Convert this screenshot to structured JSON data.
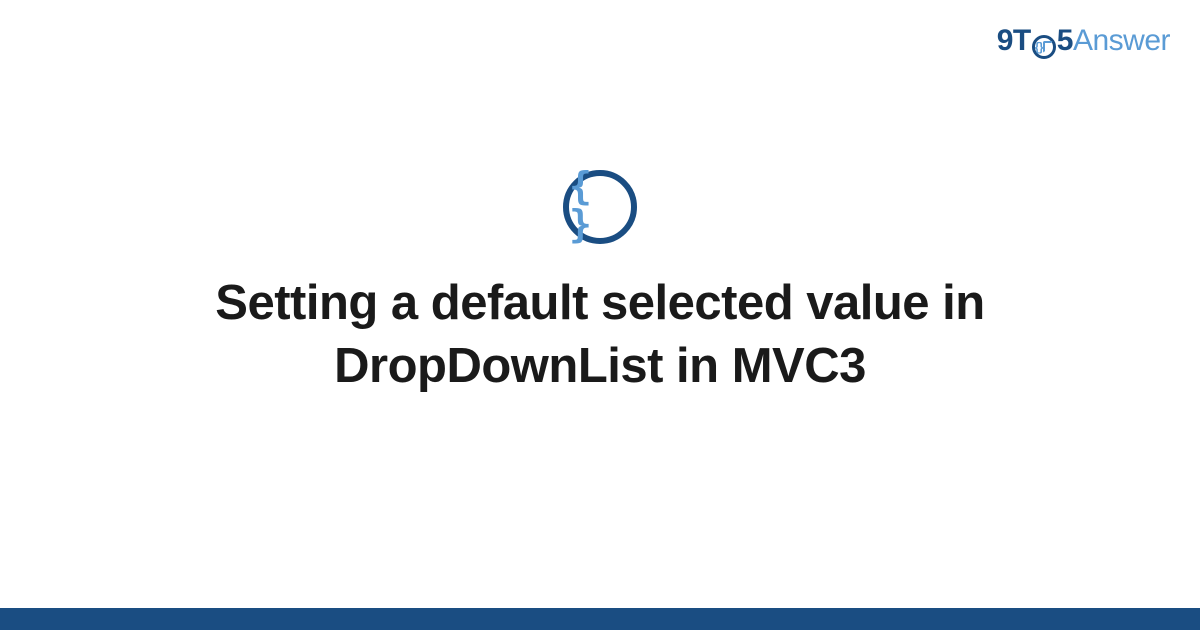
{
  "logo": {
    "part1": "9T",
    "circle_inner": "{}",
    "part2": "5",
    "part3": "Answer"
  },
  "icon": {
    "glyph": "{ }",
    "name": "code-braces-icon"
  },
  "title": "Setting a default selected value in DropDownList in MVC3",
  "colors": {
    "primary": "#1a4d82",
    "accent": "#5a9bd5",
    "text": "#1a1a1a",
    "background": "#ffffff"
  }
}
